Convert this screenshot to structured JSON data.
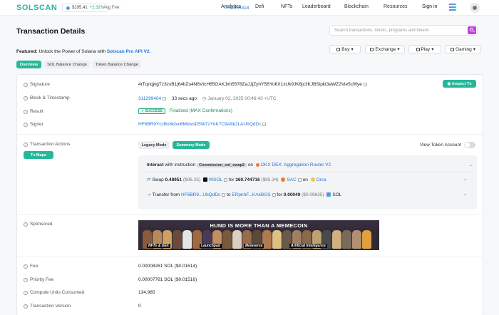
{
  "nav": {
    "logo": "SOLSCAN",
    "sol_price": "$195.41",
    "sol_change": "+2.32%",
    "avg_fee_label": "Avg Fee:",
    "avg_fee_value": "0.00005318",
    "links": [
      "Analytics",
      "Defi",
      "NFTs",
      "Leaderboard",
      "Blockchain",
      "Resources"
    ],
    "signin": "Sign in"
  },
  "header": {
    "title": "Transaction Details",
    "search_placeholder": "Search transactions, blocks, programs and tokens"
  },
  "featured": {
    "prefix": "Featured:",
    "text": "Unlock the Power of Solana with",
    "link": "Solscan Pro API V2."
  },
  "actions": [
    "Buy",
    "Exchange",
    "Play",
    "Gaming"
  ],
  "tabs": [
    "Overview",
    "SOL Balance Change",
    "Token Balance Change"
  ],
  "details": {
    "signature_label": "Signature",
    "signature": "4rTqnqjvgTz3zsB1j64bZu4N6VtcH65GAKJxh5578ZaJJjZyhY5BYo6X1xUk9JK6jc3KJBSipkt3aWZ2Vie5cWye",
    "inspect": "Inspect Tx",
    "block_label": "Block & Timestamp",
    "block": "311299404",
    "ago": "33 secs ago",
    "timestamp": "January 02, 2025 00:46:43 +UTC",
    "result_label": "Result",
    "result_badge": "SUCCESS",
    "result_text": "Finalized (MAX Confirmations)",
    "signer_label": "Signer",
    "signer": "HF6BR9YccBx8kboi6MbwsD5W7zYkK7C9A8k2LAUbQdDc",
    "actions_label": "Transaction Actions",
    "tx_maps": "Tx Maps",
    "legacy_mode": "Legacy Mode",
    "summary_mode": "Summary Mode",
    "view_token": "View Token Account",
    "interact_prefix": "Interact",
    "interact_with": "with instruction",
    "instruction": "Commission_sol_swap2",
    "on": "on",
    "program": "OKX DEX: Aggregation Router V2",
    "swap_label": "Swap",
    "swap_amount": "0.48951",
    "swap_usd": "($96.25)",
    "swap_token": "WSOL",
    "for": "for",
    "recv_amount": "360.744716",
    "recv_usd": "($95.34)",
    "recv_token": "SAC",
    "dex_on": "on",
    "dex": "Orca",
    "transfer_label": "Transfer from",
    "transfer_from": "HF6BR9...UbQdDc",
    "to": "to",
    "transfer_to": "ERpnhF...KAkBGS",
    "transfer_for": "for",
    "transfer_amount": "0.00049",
    "transfer_usd": "($0.09635)",
    "transfer_token": "SOL",
    "sponsored_label": "Sponsored",
    "banner_title": "HUND IS MORE THAN A MEMECOIN",
    "banner_captions": [
      "NFTs & DEX",
      "Launchpad",
      "Metaverse",
      "Artificial Intelligence"
    ],
    "fee_label": "Fee",
    "fee": "0.00008261 SOL ($0.01614)",
    "priority_fee_label": "Priority Fee",
    "priority_fee": "0.00007761 SOL ($0.01516)",
    "compute_label": "Compute Units Consumed",
    "compute": "134,985",
    "version_label": "Transaction Version",
    "version": "0"
  }
}
